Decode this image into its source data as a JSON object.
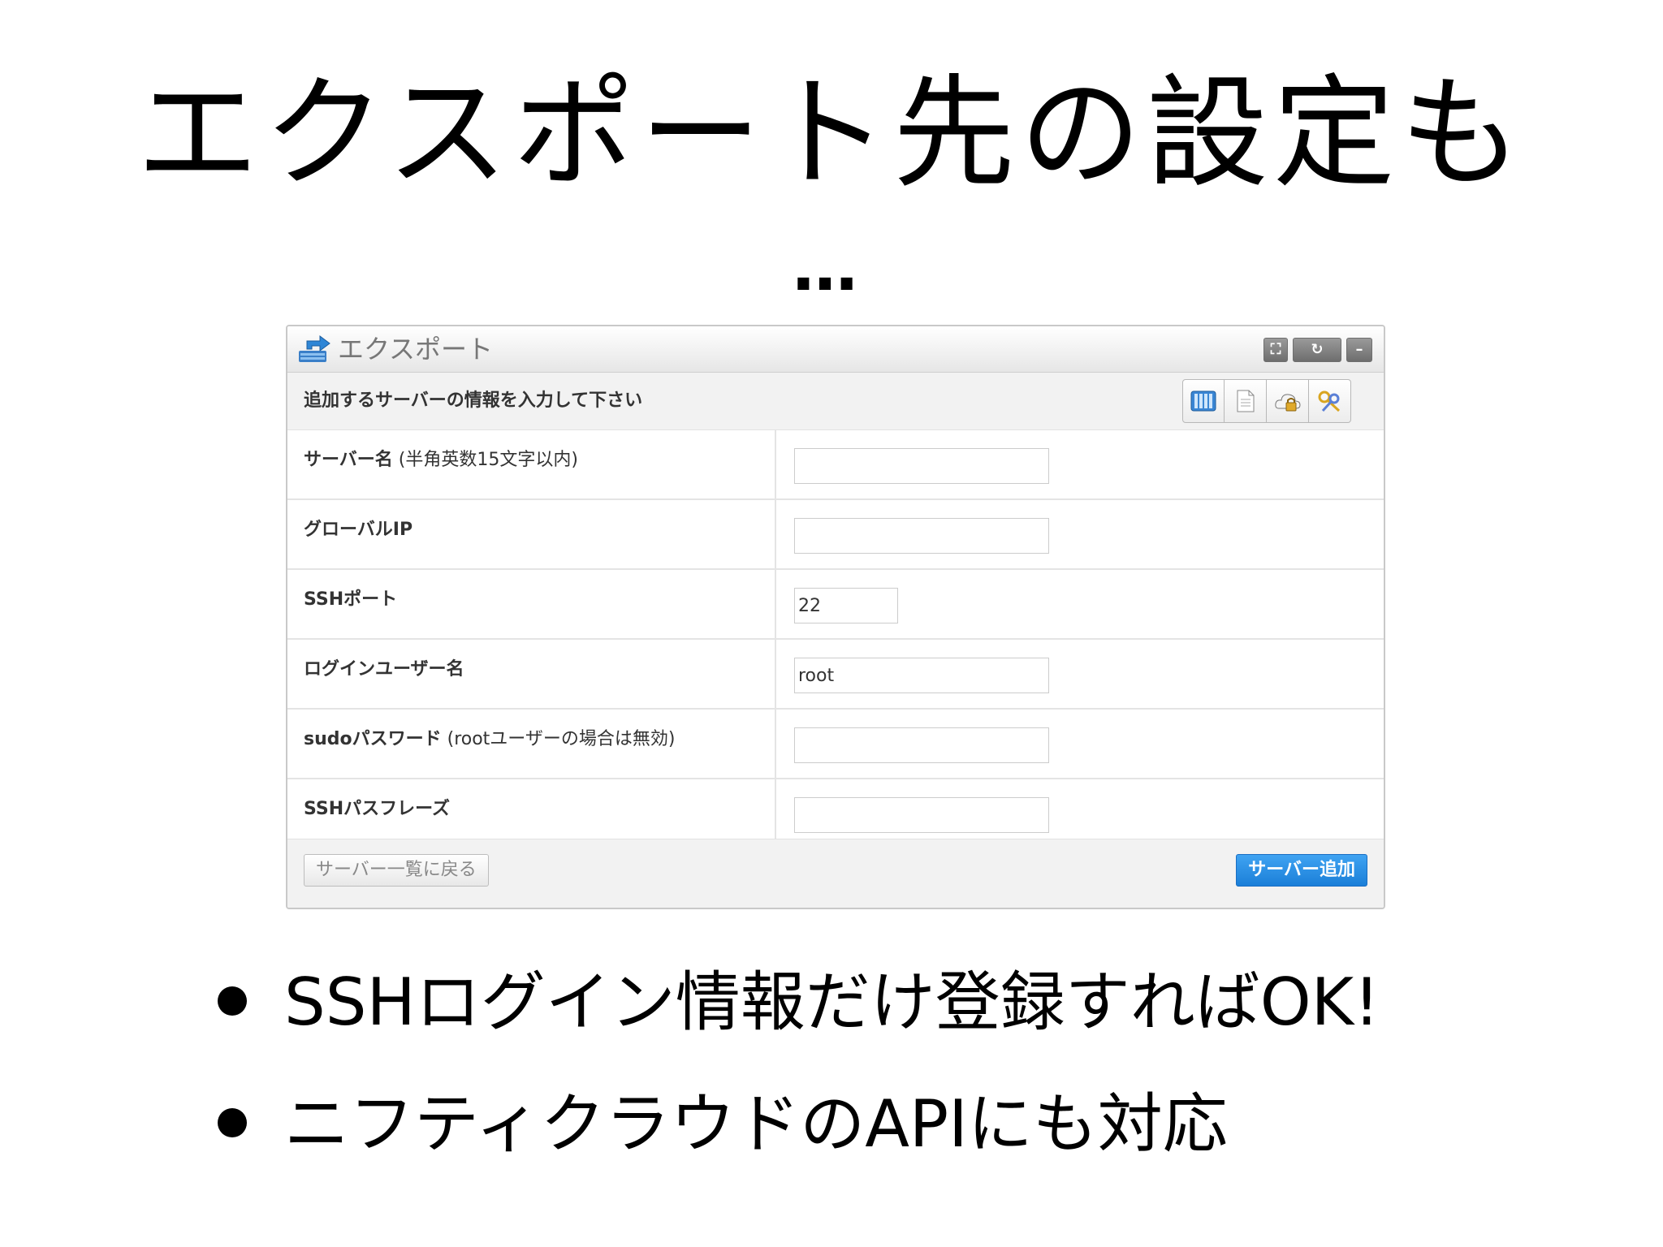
{
  "slide": {
    "title": "エクスポート先の設定も",
    "title_continuation": "…",
    "bullets": [
      "SSHログイン情報だけ登録すればOK!",
      "ニフティクラウドのAPIにも対応"
    ]
  },
  "panel": {
    "title": "エクスポート",
    "logo_icon": "export-icon",
    "header_buttons": [
      {
        "name": "maximize-icon",
        "glyph": "⛶"
      },
      {
        "name": "refresh-icon",
        "glyph": "↻"
      },
      {
        "name": "minimize-icon",
        "glyph": "–"
      }
    ],
    "instruction": "追加するサーバーの情報を入力して下さい",
    "toolbar_icons": [
      "server-list-icon",
      "document-icon",
      "cloud-lock-icon",
      "key-icon"
    ],
    "fields": [
      {
        "label": "サーバー名",
        "note": " (半角英数15文字以内)",
        "value": "",
        "size": "wide"
      },
      {
        "label": "グローバルIP",
        "note": "",
        "value": "",
        "size": "wide"
      },
      {
        "label": "SSHポート",
        "note": "",
        "value": "22",
        "size": "narrow"
      },
      {
        "label": "ログインユーザー名",
        "note": "",
        "value": "root",
        "size": "wide"
      },
      {
        "label": "sudoパスワード",
        "note": " (rootユーザーの場合は無効)",
        "value": "",
        "size": "wide"
      },
      {
        "label": "SSHパスフレーズ",
        "note": "",
        "value": "",
        "size": "wide"
      }
    ],
    "back_button": "サーバー一覧に戻る",
    "add_button": "サーバー追加"
  }
}
